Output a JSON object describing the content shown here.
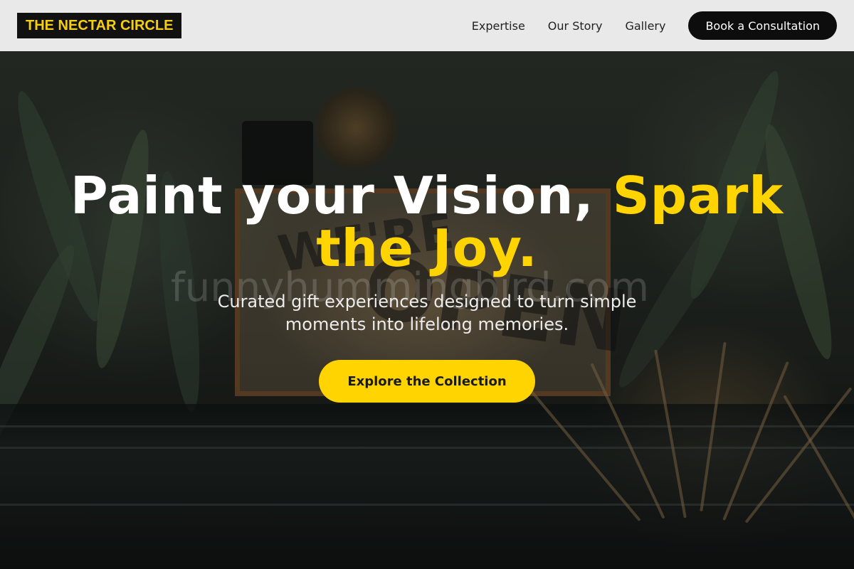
{
  "brand": {
    "logo_text": "THE NECTAR CIRCLE"
  },
  "nav": {
    "links": [
      "Expertise",
      "Our Story",
      "Gallery"
    ],
    "cta_label": "Book a Consultation"
  },
  "hero": {
    "headline_part1": "Paint your Vision, ",
    "headline_accent": "Spark the Joy.",
    "subtitle": "Curated gift experiences designed to turn simple moments into lifelong memories.",
    "cta_label": "Explore the Collection",
    "background_sign_text": "WE'RE OPEN",
    "watermark": "funnyhummingbird.com"
  },
  "colors": {
    "accent": "#ffd400",
    "header_bg": "#e9e9e9",
    "logo_bg": "#111111",
    "header_button_bg": "#0d0d0d"
  }
}
